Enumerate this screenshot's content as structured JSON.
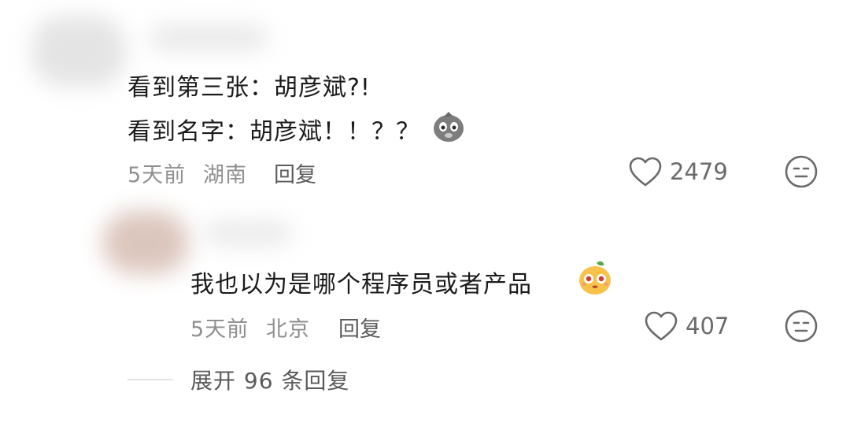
{
  "comment": {
    "lines": [
      "看到第三张：胡彦斌?!",
      "看到名字：胡彦斌！！？？"
    ],
    "time": "5天前",
    "location": "湖南",
    "reply_label": "回复",
    "like_count": "2479",
    "emoji_icon": "sad-pig-emoji-icon"
  },
  "reply": {
    "text": "我也以为是哪个程序员或者产品",
    "time": "5天前",
    "location": "北京",
    "reply_label": "回复",
    "like_count": "407",
    "emoji_icon": "mango-face-emoji-icon"
  },
  "expand": {
    "label": "展开 96 条回复"
  },
  "colors": {
    "text": "#1b1b1b",
    "meta": "#8f8f8f",
    "icon": "#6a6a6a"
  }
}
